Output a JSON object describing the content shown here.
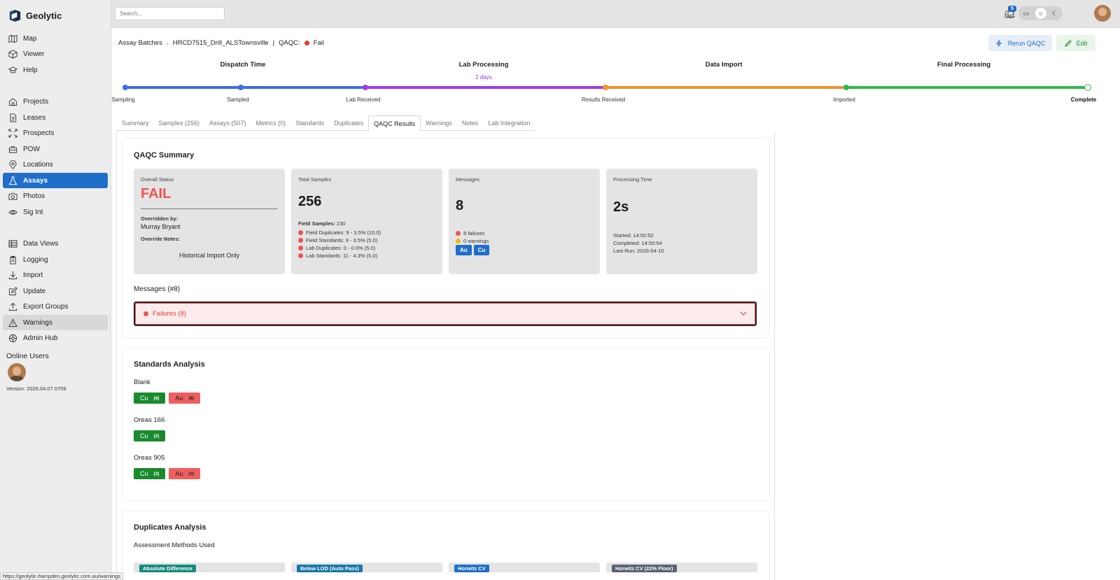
{
  "app": {
    "name": "Geolytic"
  },
  "sidebar": {
    "group1": [
      {
        "label": "Map",
        "icon": "map-icon"
      },
      {
        "label": "Viewer",
        "icon": "cube-icon"
      },
      {
        "label": "Help",
        "icon": "graduation-cap-icon"
      }
    ],
    "group2": [
      {
        "label": "Projects",
        "icon": "home-icon"
      },
      {
        "label": "Leases",
        "icon": "document-icon"
      },
      {
        "label": "Prospects",
        "icon": "arrows-icon"
      },
      {
        "label": "POW",
        "icon": "briefcase-icon"
      },
      {
        "label": "Locations",
        "icon": "pin-icon"
      },
      {
        "label": "Assays",
        "icon": "flask-icon"
      },
      {
        "label": "Photos",
        "icon": "camera-icon"
      },
      {
        "label": "Sig Int",
        "icon": "eye-icon"
      }
    ],
    "group3": [
      {
        "label": "Data Views",
        "icon": "table-icon"
      },
      {
        "label": "Logging",
        "icon": "clipboard-icon"
      },
      {
        "label": "Import",
        "icon": "download-icon"
      },
      {
        "label": "Update",
        "icon": "edit-icon"
      },
      {
        "label": "Export Groups",
        "icon": "upload-icon"
      },
      {
        "label": "Warnings",
        "icon": "warning-icon"
      },
      {
        "label": "Admin Hub",
        "icon": "settings-icon"
      }
    ],
    "online_title": "Online Users",
    "version": "Version: 2026.04.07.0759"
  },
  "topbar": {
    "search_placeholder": "Search...",
    "notification_count": "5"
  },
  "breadcrumb": {
    "root": "Assay Batches",
    "batch": "HRCD7515_Drill_ALSTownsville",
    "qaqc_label": "QAQC:",
    "qaqc_status": "Fail"
  },
  "actions": {
    "rerun": "Rerun QAQC",
    "edit": "Edit"
  },
  "timeline": {
    "phases": [
      "Dispatch Time",
      "Lab Processing",
      "Data Import",
      "Final Processing"
    ],
    "duration": "2 days",
    "steps": [
      "Sampling",
      "Sampled",
      "Lab Received",
      "Results Received",
      "Imported",
      "Complete"
    ],
    "colors": {
      "dispatch": "#3b6fe0",
      "lab": "#a23ae8",
      "import": "#f0932a",
      "final": "#2fb84b"
    }
  },
  "tabs": [
    "Summary",
    "Samples (256)",
    "Assays (507)",
    "Metrics (0)",
    "Standards",
    "Duplicates",
    "QAQC Results",
    "Warnings",
    "Notes",
    "Lab Integration"
  ],
  "active_tab": "QAQC Results",
  "qaqc_summary": {
    "title": "QAQC Summary",
    "overall": {
      "label": "Overall Status",
      "value": "FAIL",
      "overridden_by_label": "Overridden by:",
      "overridden_by": "Murray Bryant",
      "override_notes_label": "Override Notes:",
      "override_notes": "Historical Import Only"
    },
    "total_samples": {
      "label": "Total Samples",
      "value": "256",
      "field_samples_label": "Field Samples:",
      "field_samples": "230",
      "lines": [
        "Field Duplicates: 9 - 3.5% (10.0)",
        "Field Standards: 9 - 3.5% (5.0)",
        "Lab Duplicates: 0 - 0.0% (5.0)",
        "Lab Standards: 11 - 4.3% (5.0)"
      ]
    },
    "messages": {
      "label": "Messages",
      "value": "8",
      "failures": "8 failures",
      "warnings": "0 warnings",
      "elements": [
        "Au",
        "Cu"
      ]
    },
    "processing": {
      "label": "Processing Time",
      "value": "2s",
      "started": "Started: 14:50:52",
      "completed": "Completed: 14:50:54",
      "last_run": "Last Run: 2026-04-10"
    },
    "messages_header": "Messages (#8)",
    "failures_label": "Failures (8)"
  },
  "standards": {
    "title": "Standards Analysis",
    "groups": [
      {
        "name": "Blank",
        "pills": [
          {
            "el": "Cu",
            "count": "(8)",
            "status": "pass"
          },
          {
            "el": "Au",
            "count": "(8)",
            "status": "fail"
          }
        ]
      },
      {
        "name": "Oreas 166",
        "pills": [
          {
            "el": "Cu",
            "count": "(2)",
            "status": "pass"
          }
        ]
      },
      {
        "name": "Oreas 905",
        "pills": [
          {
            "el": "Cu",
            "count": "(3)",
            "status": "pass"
          },
          {
            "el": "Au",
            "count": "(3)",
            "status": "fail"
          }
        ]
      }
    ]
  },
  "duplicates": {
    "title": "Duplicates Analysis",
    "subtitle": "Assessment Methods Used",
    "methods": [
      "Absolute Difference",
      "Below LOD (Auto Pass)",
      "Horwitz CV",
      "Horwitz CV (22% Floor)"
    ]
  },
  "status_url": "https://geolytic-hampden.geolytic.com.au/warnings"
}
